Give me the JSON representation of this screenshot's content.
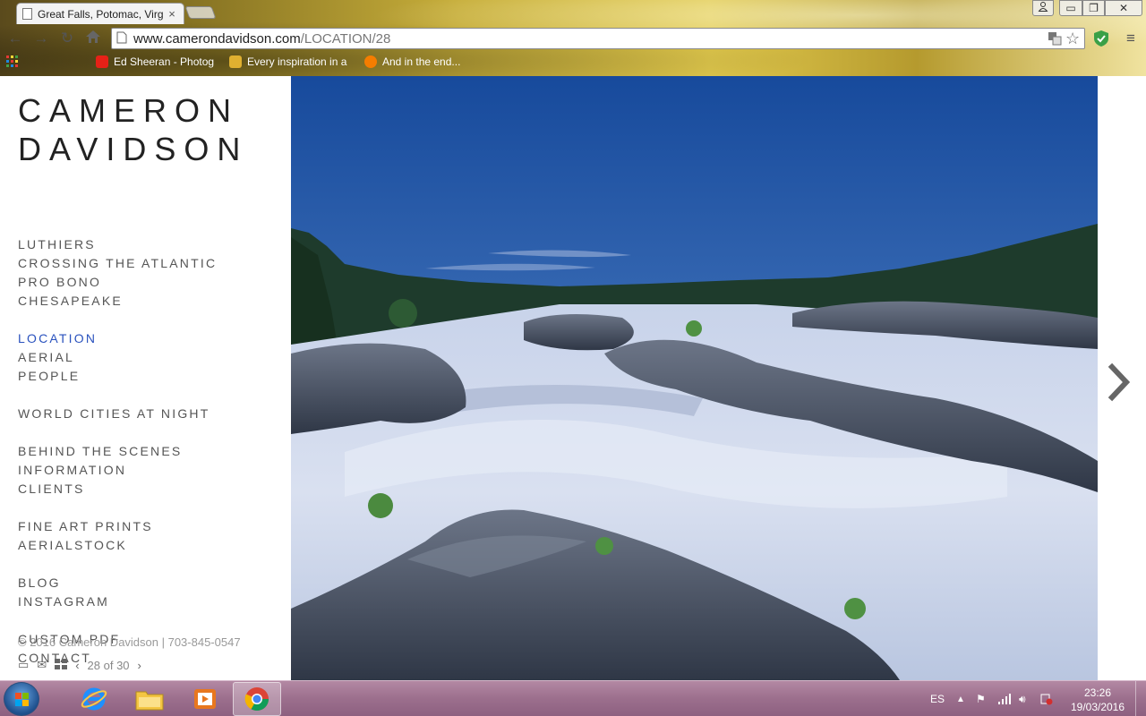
{
  "browser": {
    "tab_title": "Great Falls, Potomac, Virg",
    "tab_close": "×",
    "url_host": "www.camerondavidson.com",
    "url_path": "/LOCATION/28",
    "bookmarks": [
      {
        "label": "Ed Sheeran - Photog",
        "color": "#e62117"
      },
      {
        "label": "Every inspiration in a",
        "color": "#e0b030"
      },
      {
        "label": "And in the end...",
        "color": "#f57d00"
      }
    ]
  },
  "site": {
    "logo_line1": "CAMERON",
    "logo_line2": "DAVIDSON",
    "nav_groups": [
      [
        "LUTHIERS",
        "CROSSING THE ATLANTIC",
        "PRO BONO",
        "CHESAPEAKE"
      ],
      [
        "LOCATION",
        "AERIAL",
        "PEOPLE"
      ],
      [
        "WORLD CITIES AT NIGHT"
      ],
      [
        "BEHIND THE SCENES",
        "INFORMATION",
        "CLIENTS"
      ],
      [
        "FINE ART PRINTS",
        "AERIALSTOCK"
      ],
      [
        "BLOG",
        "INSTAGRAM"
      ],
      [
        "CUSTOM PDF",
        "CONTACT"
      ]
    ],
    "nav_active": "LOCATION",
    "accent_color": "#2a52be",
    "footer_note": "© 2016 Cameron Davidson | 703-845-0547",
    "pager_text": "28 of 30"
  },
  "photo": {
    "subject": "Great Falls, Potomac river rapids at dusk",
    "next_icon": "chevron-right-icon"
  },
  "taskbar": {
    "language": "ES",
    "time": "23:26",
    "date": "19/03/2016"
  }
}
